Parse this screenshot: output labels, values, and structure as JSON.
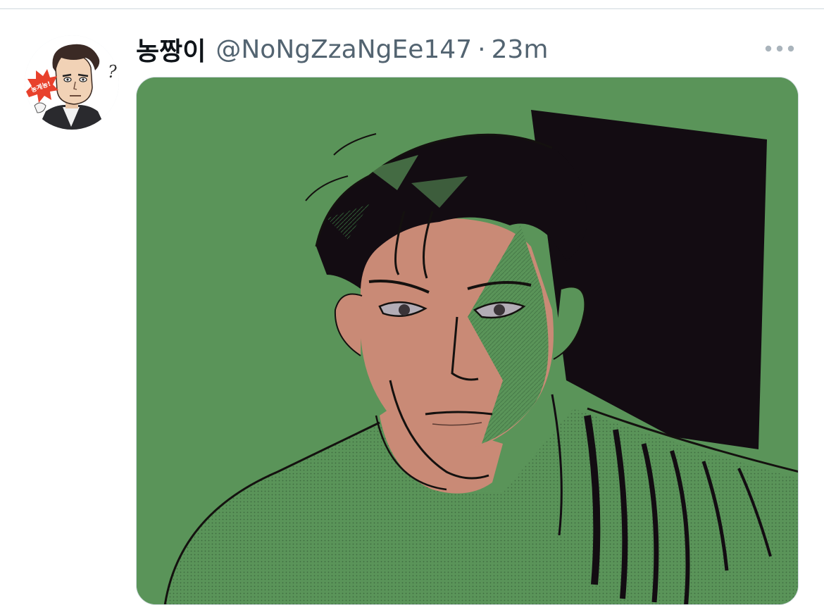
{
  "tweet": {
    "display_name": "농짱이",
    "handle": "@NoNgZzaNgEe147",
    "separator": "·",
    "time": "23m"
  },
  "avatar": {
    "badge_text": "농계농!",
    "question_mark": "?"
  },
  "icons": {
    "more": "more-horizontal-icon"
  },
  "colors": {
    "art_background": "#5a9459",
    "skin": "#c98a76",
    "shadow": "#130c12",
    "handle_gray": "#536471",
    "badge_red": "#e8412c"
  }
}
